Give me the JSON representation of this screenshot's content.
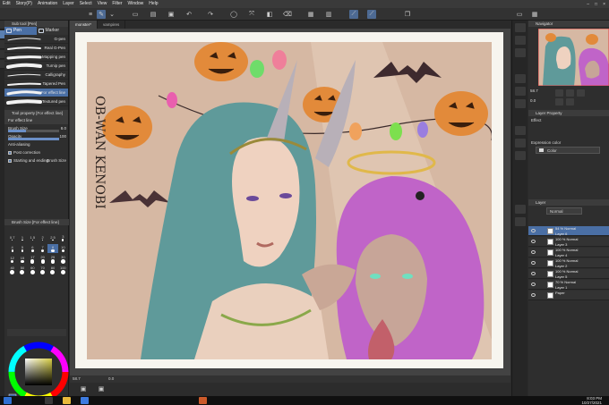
{
  "menu": {
    "items": [
      "Edit",
      "Story(P)",
      "Animation",
      "Layer",
      "Select",
      "View",
      "Filter",
      "Window",
      "Help"
    ]
  },
  "sub_tool": {
    "title": "Sub tool [Pen]",
    "tabs": [
      "Pen",
      "Marker"
    ],
    "brushes": [
      "G-pen",
      "Real G-Pen",
      "Mapping pen",
      "Turnip pen",
      "Calligraphy",
      "Tapered Pen",
      "For effect line",
      "Textured pen"
    ],
    "selected_index": 6
  },
  "tool_property": {
    "title": "Tool property [For effect line]",
    "header": "For effect line",
    "brush_size_label": "Brush Size",
    "brush_size_value": "8.0",
    "brush_size_fraction": 0.35,
    "opacity_label": "Opacity",
    "opacity_value": "100",
    "opacity_fraction": 1.0,
    "antialiasing_label": "Anti-aliasing",
    "post_correction_label": "Post correction",
    "starting_ending_label": "Starting and ending",
    "starting_ending_value": "Brush Size"
  },
  "brush_size_panel": {
    "title": "Brush Size [For effect line]",
    "sizes": [
      "0.7",
      "1",
      "1.5",
      "2",
      "2.5",
      "3",
      "4",
      "5",
      "6",
      "7",
      "8",
      "10",
      "12",
      "15",
      "17",
      "20",
      "25",
      "30",
      "40",
      "50",
      "60",
      "70",
      "80",
      "100"
    ],
    "selected": "8"
  },
  "document": {
    "tabs": [
      "monster*",
      "vampires"
    ],
    "active_tab": 0,
    "signature_text": "OB-WAN KENOBI"
  },
  "status_bar": {
    "zoom": "58.7",
    "coords": "0.0"
  },
  "navigator": {
    "title": "Navigator",
    "zoom": "58.7",
    "angle": "0.0"
  },
  "layer_property": {
    "title": "Layer Property",
    "effect_label": "Effect",
    "expression_color_label": "Expression color",
    "expression_color_value": "Color"
  },
  "layers": {
    "title": "Layer",
    "blend_mode": "Normal",
    "items": [
      {
        "mode": "54 % Normal",
        "name": "Layer 6",
        "active": true
      },
      {
        "mode": "100 % Normal",
        "name": "Layer 3",
        "active": false
      },
      {
        "mode": "100 % Normal",
        "name": "Layer 4",
        "active": false
      },
      {
        "mode": "100 % Normal",
        "name": "Layer 2",
        "active": false
      },
      {
        "mode": "100 % Normal",
        "name": "Layer 5",
        "active": false
      },
      {
        "mode": "70 % Normal",
        "name": "Layer 1",
        "active": false
      },
      {
        "mode": "",
        "name": "Paper",
        "active": false
      }
    ]
  },
  "taskbar": {
    "time": "8:03 PM",
    "date": "10/27/2021"
  },
  "colors": {
    "accent": "#4a6fa5",
    "panel": "#2e2e2e",
    "canvas_bg": "#434343",
    "art_bg": "#d8b9a4"
  },
  "icons": [
    "new-file-icon",
    "save-icon",
    "undo-icon",
    "redo-icon",
    "select-icon",
    "pen-icon",
    "eye-icon",
    "trash-icon"
  ]
}
